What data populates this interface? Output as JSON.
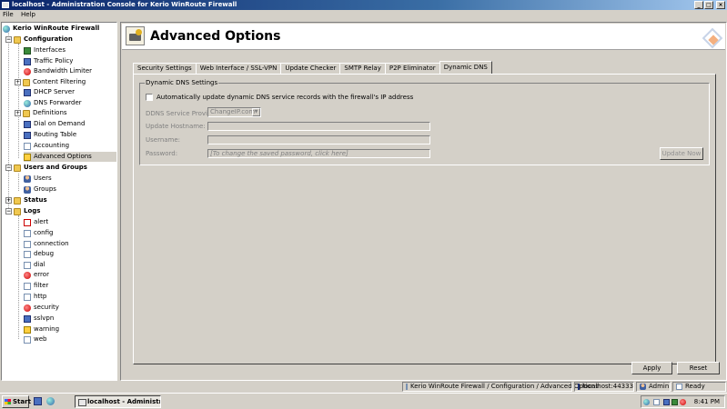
{
  "window": {
    "title": "localhost - Administration Console for Kerio WinRoute Firewall",
    "buttons": [
      "_",
      "□",
      "×"
    ]
  },
  "menu": [
    "File",
    "Help"
  ],
  "tree": {
    "root": "Kerio WinRoute Firewall",
    "configuration": {
      "label": "Configuration",
      "items": [
        "Interfaces",
        "Traffic Policy",
        "Bandwidth Limiter",
        "Content Filtering",
        "DHCP Server",
        "DNS Forwarder",
        "Definitions",
        "Dial on Demand",
        "Routing Table",
        "Accounting",
        "Advanced Options"
      ]
    },
    "users_and_groups": {
      "label": "Users and Groups",
      "items": [
        "Users",
        "Groups"
      ]
    },
    "status": {
      "label": "Status"
    },
    "logs": {
      "label": "Logs",
      "items": [
        "alert",
        "config",
        "connection",
        "debug",
        "dial",
        "error",
        "filter",
        "http",
        "security",
        "sslvpn",
        "warning",
        "web"
      ]
    },
    "selected": "Advanced Options"
  },
  "header": {
    "title": "Advanced Options"
  },
  "tabs": [
    "Security Settings",
    "Web Interface / SSL-VPN",
    "Update Checker",
    "SMTP Relay",
    "P2P Eliminator",
    "Dynamic DNS"
  ],
  "active_tab": "Dynamic DNS",
  "ddns": {
    "group_title": "Dynamic DNS Settings",
    "auto_update_label": "Automatically update dynamic DNS service records with the firewall's IP address",
    "auto_update_checked": false,
    "provider_label": "DDNS Service Provider:",
    "provider_value": "ChangeIP.com",
    "hostname_label": "Update Hostname:",
    "hostname_value": "",
    "username_label": "Username:",
    "username_value": "",
    "password_label": "Password:",
    "password_placeholder": "[To change the saved password, click here]",
    "update_now": "Update Now"
  },
  "footer": {
    "apply": "Apply",
    "reset": "Reset"
  },
  "statusbar": {
    "path": "Kerio WinRoute Firewall / Configuration / Advanced Options",
    "server": "localhost:44333",
    "user": "Admin",
    "state": "Ready"
  },
  "taskbar": {
    "start": "Start",
    "task": "localhost - Administr...",
    "clock": "8:41 PM"
  }
}
